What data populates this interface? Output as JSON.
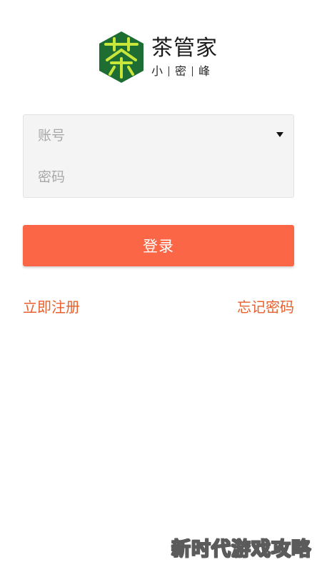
{
  "logo": {
    "badge_char": "茶",
    "brand_name": "茶管家",
    "sub_parts": [
      "小",
      "密",
      "峰"
    ],
    "badge_color": "#1e6e34",
    "badge_glyph_color": "#c9e63a"
  },
  "form": {
    "account_placeholder": "账号",
    "password_placeholder": "密码",
    "account_value": "",
    "password_value": ""
  },
  "login_button": {
    "label": "登录",
    "color": "#fb6746"
  },
  "links": {
    "register": "立即注册",
    "forgot": "忘记密码",
    "color": "#e85f2c"
  },
  "watermark": {
    "text": "新时代游戏攻略"
  }
}
